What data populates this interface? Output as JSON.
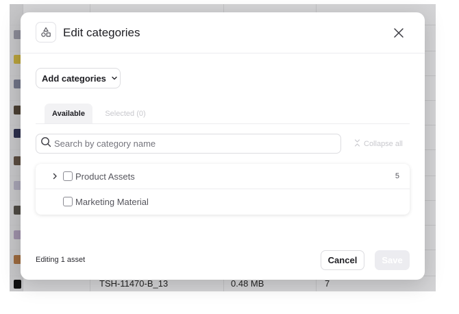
{
  "background": {
    "last_row": {
      "filename": "TSH-11470-B_13",
      "size": "0.48 MB",
      "count": "7"
    }
  },
  "modal": {
    "title": "Edit categories",
    "header_icon": "shapes-icon",
    "close_icon": "close-icon",
    "add_categories_label": "Add categories",
    "tabs": [
      {
        "label": "Available",
        "active": true
      },
      {
        "label": "Selected (0)",
        "active": false
      }
    ],
    "search": {
      "placeholder": "Search by category name",
      "value": ""
    },
    "collapse_all_label": "Collapse all",
    "categories": [
      {
        "label": "Product Assets",
        "count": "5",
        "expandable": true,
        "checked": false
      },
      {
        "label": "Marketing Material",
        "count": "",
        "expandable": false,
        "checked": false
      }
    ],
    "footer": {
      "info": "Editing 1 asset",
      "cancel_label": "Cancel",
      "save_label": "Save"
    }
  },
  "colors": {
    "accent_disabled": "#ececf0",
    "overlay": "#d4d4d6"
  }
}
